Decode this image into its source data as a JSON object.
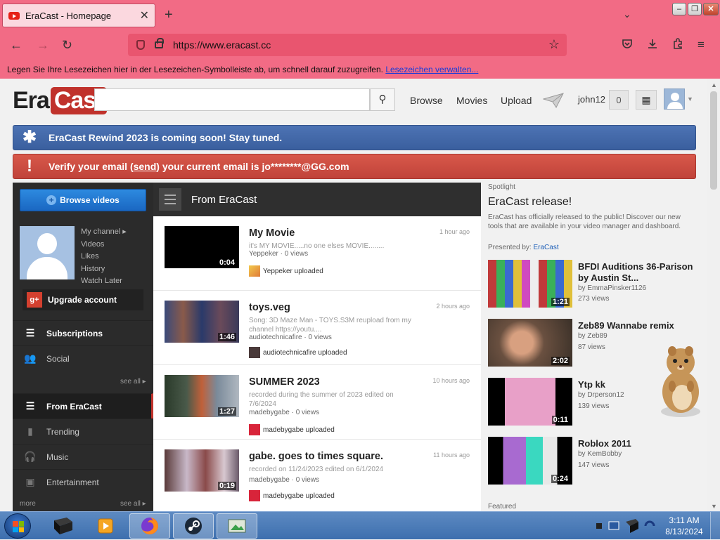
{
  "browser": {
    "tab_title": "EraCast - Homepage",
    "tab_close": "✕",
    "new_tab": "+",
    "url": "https://www.eracast.cc",
    "bookmarks_text": "Legen Sie Ihre Lesezeichen hier in der Lesezeichen-Symbolleiste ab, um schnell darauf zuzugreifen.",
    "bookmarks_link": "Lesezeichen verwalten..."
  },
  "header": {
    "logo_era": "Era",
    "logo_cast": "Cast",
    "search_placeholder": "",
    "nav": [
      "Browse",
      "Movies",
      "Upload"
    ],
    "username": "john12",
    "notifications": "0"
  },
  "banners": {
    "rewind": "EraCast Rewind 2023 is coming soon! Stay tuned.",
    "verify_pre": "Verify your email (",
    "verify_link": "send",
    "verify_post": ") your current email is jo********@GG.com"
  },
  "sidebar": {
    "browse_button": "Browse videos",
    "links": [
      "My channel ▸",
      "Videos",
      "Likes",
      "History",
      "Watch Later"
    ],
    "upgrade": "Upgrade account",
    "upgrade_icon": "g+",
    "subscriptions": "Subscriptions",
    "social": "Social",
    "see_all_1": "see all ▸",
    "from_eracast": "From EraCast",
    "trending": "Trending",
    "music": "Music",
    "entertainment": "Entertainment",
    "more": "more",
    "see_all_2": "see all ▸"
  },
  "feed": {
    "title": "From EraCast",
    "items": [
      {
        "title": "My Movie",
        "desc": "it's MY MOVIE.....no one elses MOVIE........",
        "meta": "Yeppeker · 0 views",
        "uploader": "Yeppeker uploaded",
        "ago": "1 hour ago",
        "duration": "0:04"
      },
      {
        "title": "toys.veg",
        "desc": "Song: 3D Maze Man - TOYS.S3M reupload from my channel  https://youtu....",
        "meta": "audiotechnicafire · 0 views",
        "uploader": "audiotechnicafire uploaded",
        "ago": "2 hours ago",
        "duration": "1:46"
      },
      {
        "title": "SUMMER 2023",
        "desc": "recorded during the summer of 2023 edited on 7/6/2024",
        "meta": "madebygabe · 0 views",
        "uploader": "madebygabe uploaded",
        "ago": "10 hours ago",
        "duration": "1:27"
      },
      {
        "title": "gabe. goes to times square.",
        "desc": "recorded on 11/24/2023 edited on 6/1/2024",
        "meta": "madebygabe · 0 views",
        "uploader": "madebygabe uploaded",
        "ago": "11 hours ago",
        "duration": "0:19"
      }
    ]
  },
  "spotlight": {
    "label": "Spotlight",
    "title": "EraCast release!",
    "desc": "EraCast has officially released to the public! Discover our new tools that are available in your video manager and dashboard.",
    "presented_by": "Presented by: ",
    "presenter": "EraCast",
    "videos": [
      {
        "title": "BFDI Auditions 36-Parison by Austin St...",
        "by": "by EmmaPinsker1126",
        "views": "273 views",
        "duration": "1:21"
      },
      {
        "title": "Zeb89 Wannabe remix",
        "by": "by Zeb89",
        "views": "87 views",
        "duration": "2:02"
      },
      {
        "title": "Ytp kk",
        "by": "by Drperson12",
        "views": "139 views",
        "duration": "0:11"
      },
      {
        "title": "Roblox 2011",
        "by": "by KemBobby",
        "views": "147 views",
        "duration": "0:24"
      }
    ],
    "featured": "Featured"
  },
  "taskbar": {
    "time": "3:11 AM",
    "date": "8/13/2024"
  }
}
